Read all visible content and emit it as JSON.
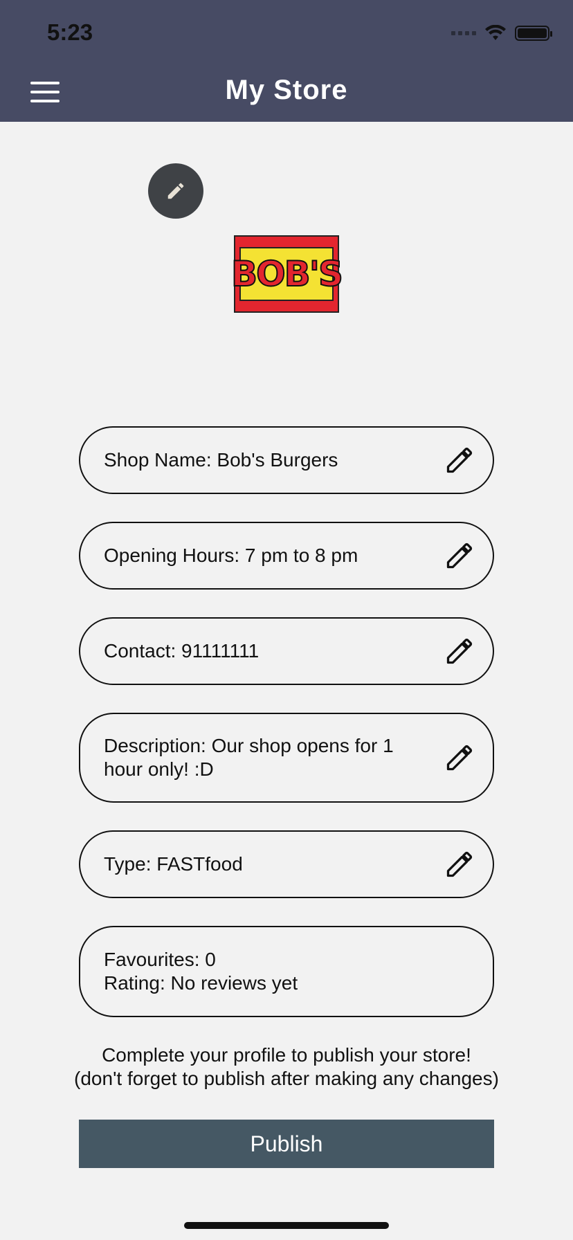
{
  "status_bar": {
    "time": "5:23"
  },
  "header": {
    "title": "My Store"
  },
  "logo": {
    "text": "BOB'S"
  },
  "fields": [
    {
      "text": "Shop Name: Bob's Burgers",
      "editable": true
    },
    {
      "text": "Opening Hours: 7 pm to 8 pm",
      "editable": true
    },
    {
      "text": "Contact: 91111111",
      "editable": true
    },
    {
      "text": "Description: Our shop opens for 1 hour only! :D",
      "editable": true
    },
    {
      "text": "Type: FASTfood",
      "editable": true
    },
    {
      "text": "Favourites: 0\nRating: No reviews yet",
      "editable": false
    }
  ],
  "info": {
    "line1": "Complete your profile to publish your store!",
    "line2": "(don't forget to publish after making any changes)"
  },
  "publish_label": "Publish",
  "colors": {
    "header": "#474b64",
    "publish": "#455864",
    "background": "#f2f2f2"
  }
}
